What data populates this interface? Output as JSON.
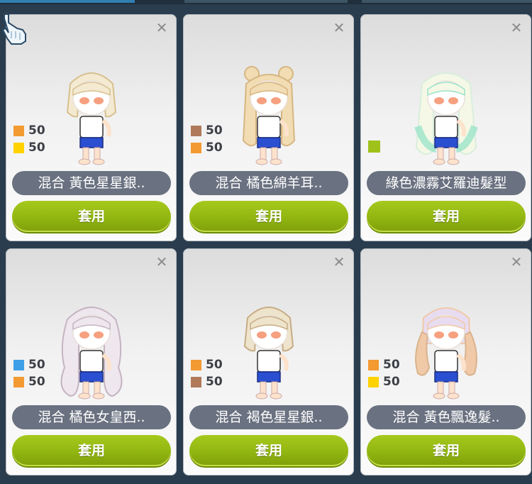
{
  "colors": {
    "orange": "#f39a32",
    "yellow": "#ffd200",
    "brown": "#b07a5a",
    "blue": "#3d9fe8",
    "green": "#9fc21a"
  },
  "cards": [
    {
      "name": "混合 黃色星星銀..",
      "apply_label": "套用",
      "close_icon": "✕",
      "stats": [
        {
          "color": "#f39a32",
          "value": "50"
        },
        {
          "color": "#ffd200",
          "value": "50"
        }
      ],
      "hair": {
        "main": "#f4ead2",
        "shade": "#d7c08f",
        "style": "short-stars"
      }
    },
    {
      "name": "混合 橘色綿羊耳..",
      "apply_label": "套用",
      "close_icon": "✕",
      "stats": [
        {
          "color": "#b07a5a",
          "value": "50"
        },
        {
          "color": "#f39a32",
          "value": "50"
        }
      ],
      "hair": {
        "main": "#f1dcb3",
        "shade": "#d7b681",
        "style": "buns-long"
      }
    },
    {
      "name": "綠色濃霧艾羅迪髮型",
      "apply_label": "套用",
      "close_icon": "✕",
      "stats": [],
      "swatch": "#9fc21a",
      "hair": {
        "main": "#f5f8e6",
        "shade": "#9be3c9",
        "style": "long-green"
      }
    },
    {
      "name": "混合 橘色女皇西..",
      "apply_label": "套用",
      "close_icon": "✕",
      "stats": [
        {
          "color": "#3d9fe8",
          "value": "50"
        },
        {
          "color": "#f39a32",
          "value": "50"
        }
      ],
      "hair": {
        "main": "#efe7ee",
        "shade": "#c4b4c2",
        "style": "long-wavy"
      }
    },
    {
      "name": "混合 褐色星星銀..",
      "apply_label": "套用",
      "close_icon": "✕",
      "stats": [
        {
          "color": "#f39a32",
          "value": "50"
        },
        {
          "color": "#b07a5a",
          "value": "50"
        }
      ],
      "hair": {
        "main": "#eee3cb",
        "shade": "#c7ac84",
        "style": "short-stars"
      }
    },
    {
      "name": "混合 黃色飄逸髮..",
      "apply_label": "套用",
      "close_icon": "✕",
      "stats": [
        {
          "color": "#f39a32",
          "value": "50"
        },
        {
          "color": "#ffd200",
          "value": "50"
        }
      ],
      "hair": {
        "main": "#e8dcf0",
        "shade": "#f0c9a8",
        "style": "twintails"
      }
    }
  ]
}
